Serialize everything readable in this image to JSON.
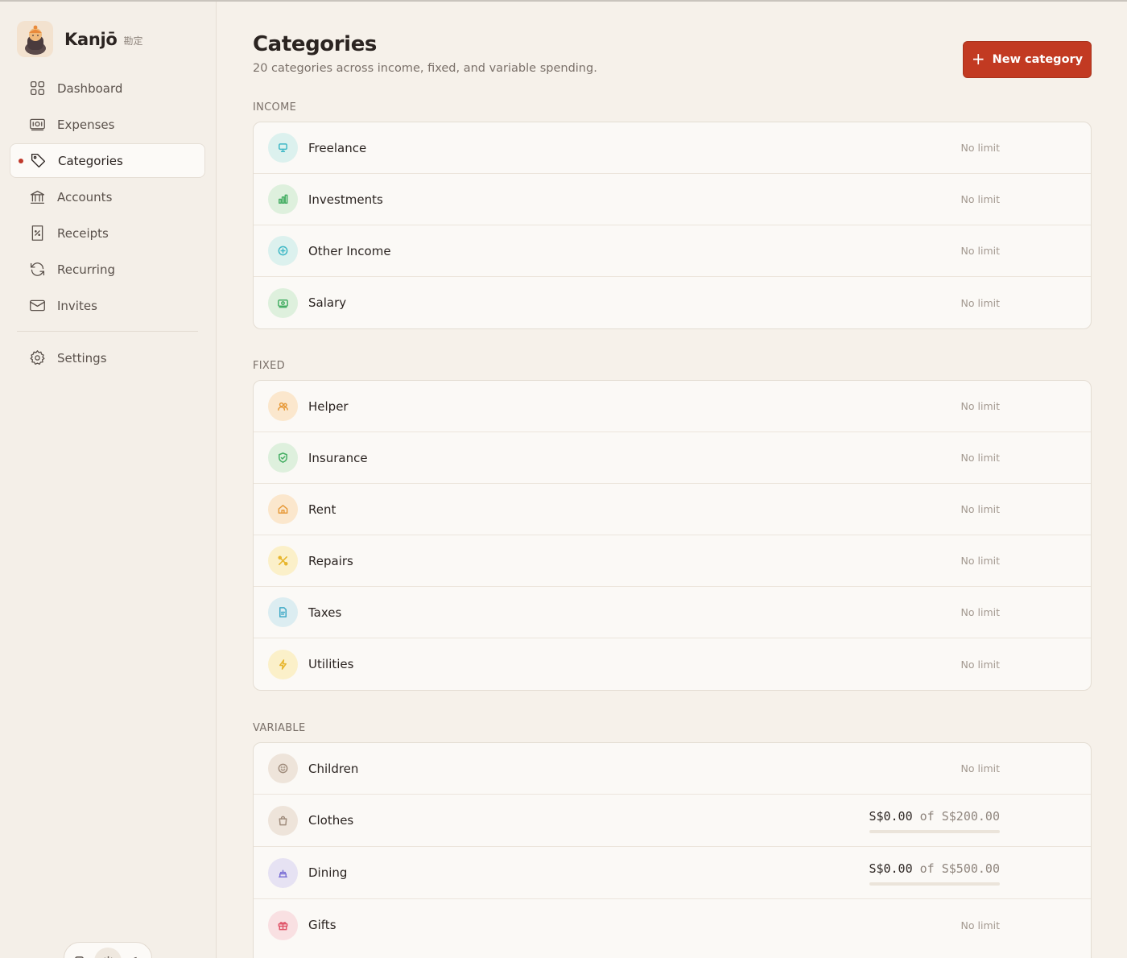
{
  "app": {
    "name": "Kanjō",
    "subtitle": "勘定"
  },
  "sidebar": {
    "items": [
      {
        "label": "Dashboard",
        "icon": "dashboard-icon",
        "active": false
      },
      {
        "label": "Expenses",
        "icon": "banknote-icon",
        "active": false
      },
      {
        "label": "Categories",
        "icon": "tag-icon",
        "active": true
      },
      {
        "label": "Accounts",
        "icon": "bank-icon",
        "active": false
      },
      {
        "label": "Receipts",
        "icon": "receipt-icon",
        "active": false
      },
      {
        "label": "Recurring",
        "icon": "refresh-icon",
        "active": false
      },
      {
        "label": "Invites",
        "icon": "mail-icon",
        "active": false
      }
    ],
    "settings": {
      "label": "Settings",
      "icon": "gear-icon"
    },
    "theme_toggle": {
      "options": [
        "system-icon",
        "sun-icon",
        "moon-icon"
      ],
      "selected": "sun-icon"
    }
  },
  "header": {
    "title": "Categories",
    "subtitle": "20 categories across income, fixed, and variable spending.",
    "new_button": {
      "plus": "+",
      "label": "New category"
    }
  },
  "colors": {
    "accent": "#c23a22"
  },
  "sections": {
    "income": {
      "label": "INCOME",
      "rows": [
        {
          "name": "Freelance",
          "limit": "No limit",
          "icon": "monitor-icon",
          "color": "#3fb8c6",
          "bg": "#dcf1ee"
        },
        {
          "name": "Investments",
          "limit": "No limit",
          "icon": "bar-chart-icon",
          "color": "#46ae64",
          "bg": "#def0dd"
        },
        {
          "name": "Other Income",
          "limit": "No limit",
          "icon": "plus-circle-icon",
          "color": "#3fb8c6",
          "bg": "#dcf1ee"
        },
        {
          "name": "Salary",
          "limit": "No limit",
          "icon": "banknote-icon",
          "color": "#46ae64",
          "bg": "#def0dd"
        }
      ]
    },
    "fixed": {
      "label": "FIXED",
      "rows": [
        {
          "name": "Helper",
          "limit": "No limit",
          "icon": "users-icon",
          "color": "#e79a3a",
          "bg": "#fbe7cd"
        },
        {
          "name": "Insurance",
          "limit": "No limit",
          "icon": "shield-check-icon",
          "color": "#46ae64",
          "bg": "#def0dd"
        },
        {
          "name": "Rent",
          "limit": "No limit",
          "icon": "home-icon",
          "color": "#e79a3a",
          "bg": "#fbe7cd"
        },
        {
          "name": "Repairs",
          "limit": "No limit",
          "icon": "wrench-icon",
          "color": "#e7b52a",
          "bg": "#fbf0c9"
        },
        {
          "name": "Taxes",
          "limit": "No limit",
          "icon": "document-icon",
          "color": "#3fa9c6",
          "bg": "#dcedf1"
        },
        {
          "name": "Utilities",
          "limit": "No limit",
          "icon": "lightning-icon",
          "color": "#e7b52a",
          "bg": "#fbf0c9"
        }
      ]
    },
    "variable": {
      "label": "VARIABLE",
      "rows": [
        {
          "name": "Children",
          "limit": "No limit",
          "icon": "smile-icon",
          "color": "#a08c7c",
          "bg": "#eee4da"
        },
        {
          "name": "Clothes",
          "spent": "S$0.00",
          "of": "of",
          "budget": "S$200.00",
          "progress": 0,
          "icon": "shopping-bag-icon",
          "color": "#a08c7c",
          "bg": "#eee4da"
        },
        {
          "name": "Dining",
          "spent": "S$0.00",
          "of": "of",
          "budget": "S$500.00",
          "progress": 0,
          "icon": "cake-icon",
          "color": "#7d72d6",
          "bg": "#e6e2f3"
        },
        {
          "name": "Gifts",
          "limit": "No limit",
          "icon": "gift-icon",
          "color": "#e0566a",
          "bg": "#f9e0e2"
        }
      ]
    }
  }
}
